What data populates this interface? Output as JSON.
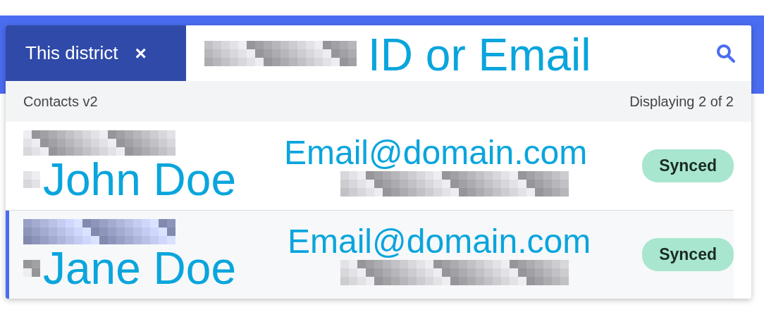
{
  "filter_tab": {
    "label": "This district",
    "close": "×"
  },
  "search": {
    "annotation": "ID or Email"
  },
  "list_header": {
    "title": "Contacts v2",
    "count": "Displaying 2 of 2"
  },
  "contacts": [
    {
      "name_annotation": "John Doe",
      "email_annotation": "Email@domain.com",
      "status": "Synced",
      "selected": false
    },
    {
      "name_annotation": "Jane Doe",
      "email_annotation": "Email@domain.com",
      "status": "Synced",
      "selected": true
    }
  ]
}
